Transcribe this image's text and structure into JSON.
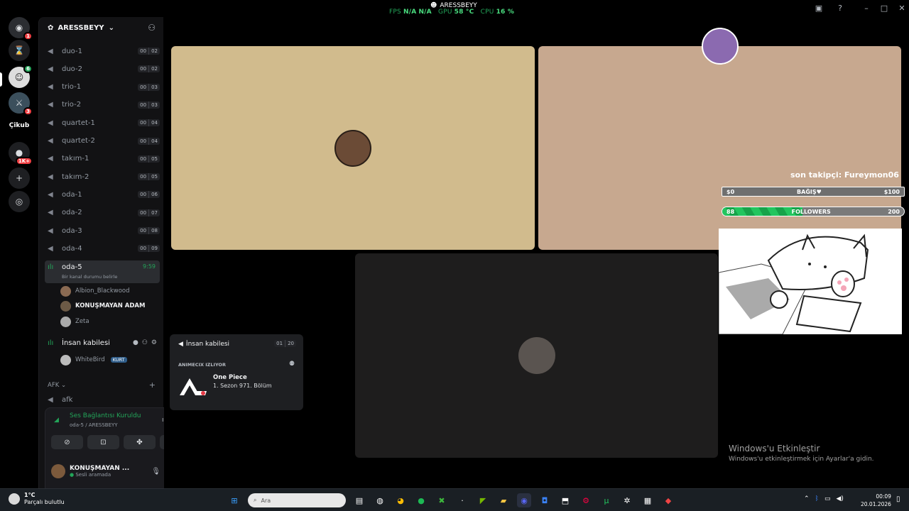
{
  "overlay": {
    "fps_label": "FPS",
    "fps_value": "N/A",
    "fps_value2": "N/A",
    "gpu_label": "GPU",
    "gpu_value": "58 °C",
    "cpu_label": "CPU",
    "cpu_value": "16 %",
    "username": "ARESSBEYY"
  },
  "rail": {
    "badge_1": "1",
    "badge_2": "6",
    "badge_3": "3",
    "server_text": "Çikub",
    "badge_1k": "1K+"
  },
  "server": {
    "name": "ARESSBEYY"
  },
  "channels": [
    {
      "name": "duo-1",
      "a": "00",
      "b": "02"
    },
    {
      "name": "duo-2",
      "a": "00",
      "b": "02"
    },
    {
      "name": "trio-1",
      "a": "00",
      "b": "03"
    },
    {
      "name": "trio-2",
      "a": "00",
      "b": "03"
    },
    {
      "name": "quartet-1",
      "a": "00",
      "b": "04"
    },
    {
      "name": "quartet-2",
      "a": "00",
      "b": "04"
    },
    {
      "name": "takım-1",
      "a": "00",
      "b": "05"
    },
    {
      "name": "takım-2",
      "a": "00",
      "b": "05"
    },
    {
      "name": "oda-1",
      "a": "00",
      "b": "06"
    },
    {
      "name": "oda-2",
      "a": "00",
      "b": "07"
    },
    {
      "name": "oda-3",
      "a": "00",
      "b": "08"
    },
    {
      "name": "oda-4",
      "a": "00",
      "b": "09"
    }
  ],
  "active_channel": {
    "name": "oda-5",
    "timer": "9:59",
    "status": "Bir kanal durumu belirle",
    "users": [
      "Albion_Blackwood",
      "KONUŞMAYAN ADAM",
      "Zeta"
    ]
  },
  "insan_channel": {
    "name": "İnsan kabilesi",
    "user": "WhiteBird",
    "tag": "KURT"
  },
  "afk": {
    "category": "AFK",
    "channel": "afk"
  },
  "voice_panel": {
    "status": "Ses Bağlantısı Kuruldu",
    "location": "oda-5 / ARESSBEYY"
  },
  "me": {
    "name": "KONUŞMAYAN ...",
    "status": "Sesli aramada"
  },
  "popup": {
    "channel": "İnsan kabilesi",
    "count_a": "01",
    "count_b": "20",
    "activity": "ANIMECIX IZLIYOR",
    "title": "One Piece",
    "episode": "1. Sezon 971. Bölüm"
  },
  "stream": {
    "follower_text": "son takipçi: Fureymon06",
    "donation_left": "$0",
    "donation_label": "BAĞIŞ♥",
    "donation_right": "$100",
    "followers_left": "88",
    "followers_label": "FOLLOWERS",
    "followers_right": "200",
    "followers_progress": 0.44
  },
  "activation": {
    "title": "Windows'u Etkinleştir",
    "subtitle": "Windows'u etkinleştirmek için Ayarlar'a gidin."
  },
  "taskbar": {
    "weather_temp": "1°C",
    "weather_text": "Parçalı bulutlu",
    "search_placeholder": "Ara",
    "time": "00:09",
    "date": "20.01.2026"
  },
  "colors": {
    "tile_1": "#d1bb8d",
    "tile_2": "#c7a88f",
    "tile_3": "#1e1d1d",
    "accent_green": "#23a559"
  }
}
